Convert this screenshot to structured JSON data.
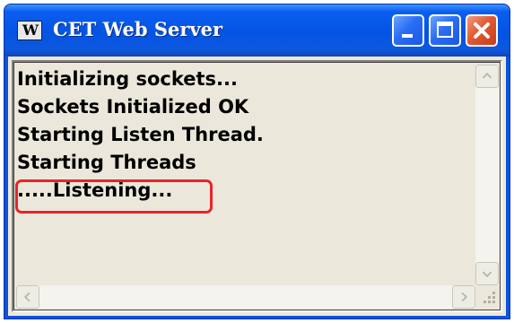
{
  "window": {
    "title": "CET Web Server",
    "icon": "app-icon",
    "icon_text": "W"
  },
  "controls": {
    "minimize_icon": "minimize-icon",
    "maximize_icon": "maximize-icon",
    "close_icon": "close-icon"
  },
  "console": {
    "lines": [
      "Initializing sockets...",
      "Sockets Initialized OK",
      "Starting Listen Thread.",
      "Starting Threads",
      ".....Listening..."
    ],
    "highlighted_line_index": 4
  },
  "colors": {
    "titlebar": "#0553e3",
    "close_button": "#e15a34",
    "console_bg": "#ebe8db",
    "highlight_box": "#e8242a"
  },
  "scrollbars": {
    "up_icon": "scroll-up-arrow-icon",
    "down_icon": "scroll-down-arrow-icon",
    "left_icon": "scroll-left-arrow-icon",
    "right_icon": "scroll-right-arrow-icon",
    "grip_icon": "resize-grip-icon"
  }
}
